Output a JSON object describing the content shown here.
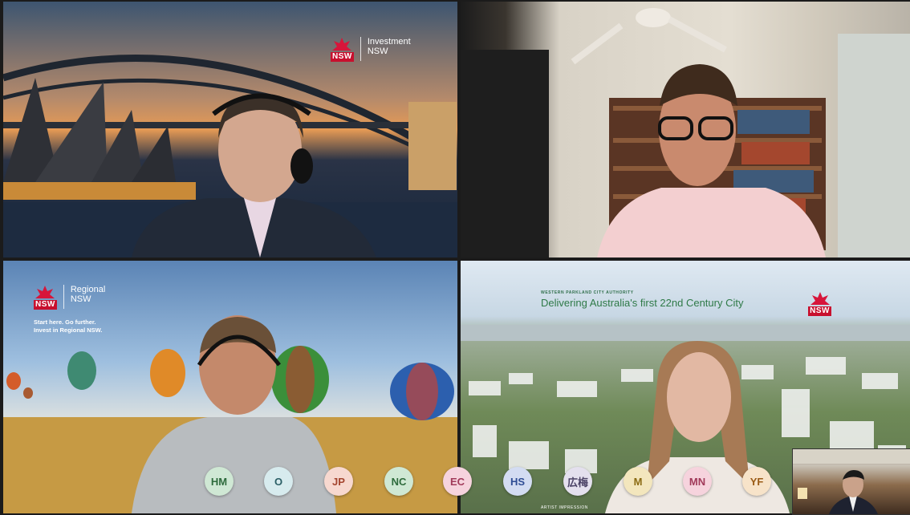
{
  "tiles": {
    "top_left": {
      "logo_nsw": "NSW",
      "logo_brand_line1": "Investment",
      "logo_brand_line2": "NSW"
    },
    "bottom_left": {
      "logo_nsw": "NSW",
      "logo_brand_line1": "Regional",
      "logo_brand_line2": "NSW",
      "tagline_line1": "Start here. Go further.",
      "tagline_line2": "Invest in Regional NSW."
    },
    "bottom_right": {
      "banner_small": "WESTERN PARKLAND CITY AUTHORITY",
      "banner_title": "Delivering Australia's first 22nd Century City",
      "logo_nsw": "NSW",
      "artist_note": "ARTIST IMPRESSION"
    }
  },
  "participants": [
    {
      "initials": "HM",
      "color": "#cfe8d4",
      "text_color": "#2e6b3c"
    },
    {
      "initials": "O",
      "color": "#d7ebee",
      "text_color": "#2b5f66"
    },
    {
      "initials": "JP",
      "color": "#f7d8cf",
      "text_color": "#a4452f"
    },
    {
      "initials": "NC",
      "color": "#cfe8d4",
      "text_color": "#2e6b3c"
    },
    {
      "initials": "EC",
      "color": "#f6d3dd",
      "text_color": "#a13a5a"
    },
    {
      "initials": "HS",
      "color": "#d3dcf2",
      "text_color": "#2f4d94"
    },
    {
      "initials": "広梅",
      "color": "#e4e0ee",
      "text_color": "#4b4266"
    },
    {
      "initials": "M",
      "color": "#f3e6bd",
      "text_color": "#8a6a12"
    },
    {
      "initials": "MN",
      "color": "#f6d3dd",
      "text_color": "#a13a5a"
    },
    {
      "initials": "YF",
      "color": "#f7e3c9",
      "text_color": "#9a5b16"
    }
  ]
}
